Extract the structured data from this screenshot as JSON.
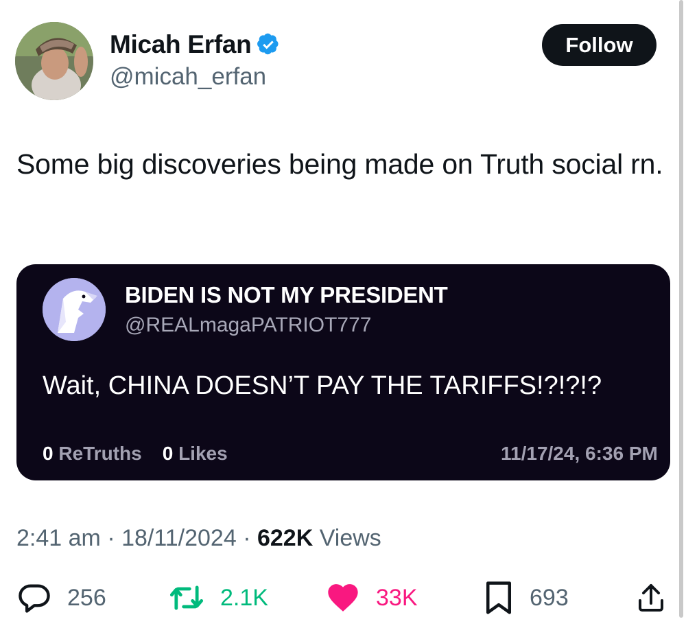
{
  "author": {
    "display_name": "Micah Erfan",
    "handle": "@micah_erfan",
    "follow_label": "Follow"
  },
  "tweet": {
    "text": "Some big discoveries being made on Truth social rn."
  },
  "embedded_post": {
    "display_name": "BIDEN IS NOT MY PRESIDENT",
    "handle": "@REALmagaPATRIOT777",
    "text": "Wait, CHINA DOESN’T PAY THE TARIFFS!?!?!?",
    "retruths_count": "0",
    "retruths_label": "ReTruths",
    "likes_count": "0",
    "likes_label": "Likes",
    "timestamp": "11/17/24, 6:36 PM"
  },
  "meta": {
    "time": "2:41 am",
    "date": "18/11/2024",
    "views_count": "622K",
    "views_label": "Views"
  },
  "actions": {
    "replies": "256",
    "reposts": "2.1K",
    "likes": "33K",
    "bookmarks": "693"
  },
  "colors": {
    "verified": "#1d9bf0",
    "repost": "#00ba7c",
    "like": "#f91880",
    "card_bg": "#0c0718"
  }
}
